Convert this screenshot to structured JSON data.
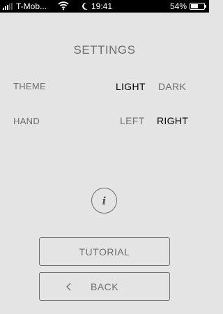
{
  "status_bar": {
    "carrier": "T-Mob...",
    "time": "19:41",
    "battery_percent": "54%",
    "battery_level": 0.54
  },
  "settings": {
    "title": "SETTINGS",
    "theme": {
      "label": "THEME",
      "options": [
        "LIGHT",
        "DARK"
      ],
      "selected": "LIGHT"
    },
    "hand": {
      "label": "HAND",
      "options": [
        "LEFT",
        "RIGHT"
      ],
      "selected": "RIGHT"
    }
  },
  "info": {
    "glyph": "i"
  },
  "buttons": {
    "tutorial": "TUTORIAL",
    "back": "BACK"
  },
  "colors": {
    "background": "#e4e4e4",
    "text_muted": "#6e6e6e",
    "text_active": "#000000",
    "status_bar": "#000000"
  }
}
